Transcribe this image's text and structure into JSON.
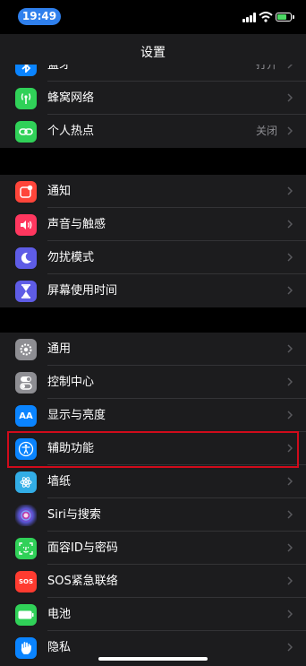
{
  "status_bar": {
    "time": "19:49"
  },
  "nav": {
    "title": "设置"
  },
  "group1": [
    {
      "label": "蓝牙",
      "value": "打开",
      "icon": "bluetooth-icon",
      "color": "#0a84ff"
    },
    {
      "label": "蜂窝网络",
      "value": "",
      "icon": "antenna-icon",
      "color": "#30d158"
    },
    {
      "label": "个人热点",
      "value": "关闭",
      "icon": "hotspot-icon",
      "color": "#30d158"
    }
  ],
  "group2": [
    {
      "label": "通知",
      "icon": "notifications-icon",
      "color": "#ff453a"
    },
    {
      "label": "声音与触感",
      "icon": "sound-icon",
      "color": "#ff375f"
    },
    {
      "label": "勿扰模式",
      "icon": "moon-icon",
      "color": "#5e5ce6"
    },
    {
      "label": "屏幕使用时间",
      "icon": "hourglass-icon",
      "color": "#5e5ce6"
    }
  ],
  "group3": [
    {
      "label": "通用",
      "icon": "gear-icon",
      "color": "#8e8e93"
    },
    {
      "label": "控制中心",
      "icon": "toggles-icon",
      "color": "#8e8e93"
    },
    {
      "label": "显示与亮度",
      "icon": "text-size-icon",
      "color": "#0a84ff",
      "glyph": "AA"
    },
    {
      "label": "辅助功能",
      "icon": "accessibility-icon",
      "color": "#0a84ff"
    },
    {
      "label": "墙纸",
      "icon": "flower-icon",
      "color": "#32ade6"
    },
    {
      "label": "Siri与搜索",
      "icon": "siri-icon",
      "color": "#1c1c1e"
    },
    {
      "label": "面容ID与密码",
      "icon": "face-id-icon",
      "color": "#30d158"
    },
    {
      "label": "SOS紧急联络",
      "icon": "sos-icon",
      "color": "#ff3b30",
      "glyph": "SOS"
    },
    {
      "label": "电池",
      "icon": "battery-icon",
      "color": "#30d158"
    },
    {
      "label": "隐私",
      "icon": "hand-icon",
      "color": "#0a84ff"
    }
  ]
}
